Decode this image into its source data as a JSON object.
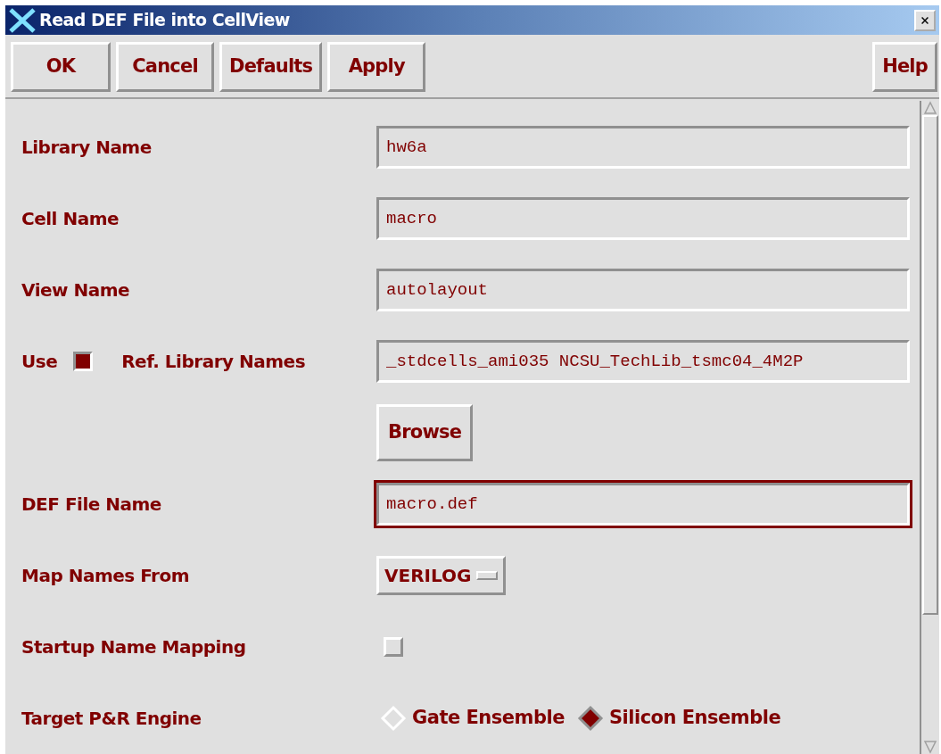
{
  "window": {
    "title": "Read DEF File into CellView"
  },
  "buttons": [
    {
      "label": "OK"
    },
    {
      "label": "Cancel"
    },
    {
      "label": "Defaults"
    },
    {
      "label": "Apply"
    }
  ],
  "help_button": {
    "label": "Help"
  },
  "rows": [
    {
      "kind": "field",
      "label": "Library Name",
      "value": "hw6a",
      "focused": false
    },
    {
      "kind": "field",
      "label": "Cell Name",
      "value": "macro",
      "focused": false
    },
    {
      "kind": "field",
      "label": "View Name",
      "value": "autolayout",
      "focused": false
    },
    {
      "kind": "reflib",
      "label": "Use",
      "checked": true,
      "label_2": "Ref. Library Names",
      "value": "_stdcells_ami035 NCSU_TechLib_tsmc04_4M2P"
    },
    {
      "kind": "button",
      "label": "Browse"
    },
    {
      "kind": "field",
      "label": "DEF File Name",
      "value": "macro.def",
      "focused": true
    },
    {
      "kind": "dropdown",
      "label": "Map Names From",
      "value": "VERILOG"
    },
    {
      "kind": "checkbox",
      "label": "Startup Name Mapping",
      "checked": false
    },
    {
      "kind": "radio",
      "label": "Target P&R Engine",
      "options": [
        {
          "label": "Gate Ensemble",
          "selected": false
        },
        {
          "label": "Silicon Ensemble",
          "selected": true
        }
      ]
    }
  ]
}
